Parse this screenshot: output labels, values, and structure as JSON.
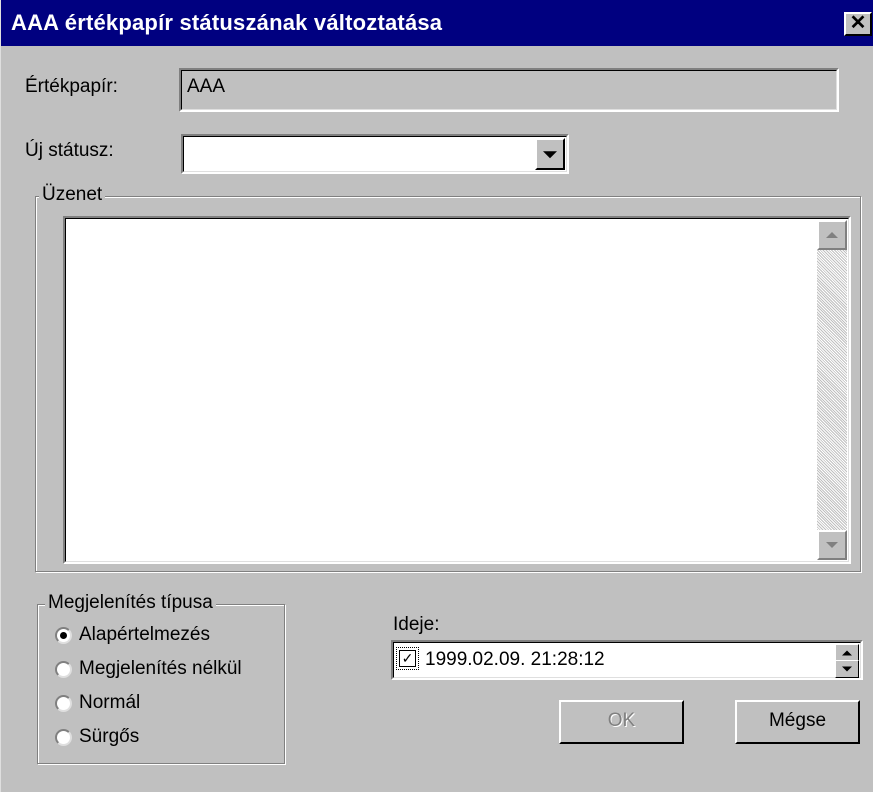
{
  "window": {
    "title": "AAA értékpapír státuszának változtatása",
    "close_glyph": "✕",
    "close_icon": "close-icon",
    "colors": {
      "titlebar": "#000080",
      "face": "#c0c0c0",
      "field": "#ffffff",
      "disabled_text": "#808080"
    }
  },
  "security": {
    "label": "Értékpapír:",
    "value": "AAA"
  },
  "new_status": {
    "label": "Új státusz:",
    "value": "",
    "dropdown_icon": "chevron-down-icon"
  },
  "message": {
    "group_label": "Üzenet",
    "value": ""
  },
  "display_type": {
    "group_label": "Megjelenítés típusa",
    "selected": "Alapértelmezés",
    "options": [
      {
        "label": "Alapértelmezés",
        "checked": true
      },
      {
        "label": "Megjelenítés nélkül",
        "checked": false
      },
      {
        "label": "Normál",
        "checked": false
      },
      {
        "label": "Sürgős",
        "checked": false
      }
    ]
  },
  "time": {
    "label": "Ideje:",
    "enabled": true,
    "check_glyph": "✓",
    "value": "1999.02.09. 21:28:12"
  },
  "buttons": {
    "ok_label": "OK",
    "ok_disabled": true,
    "cancel_label": "Mégse"
  }
}
